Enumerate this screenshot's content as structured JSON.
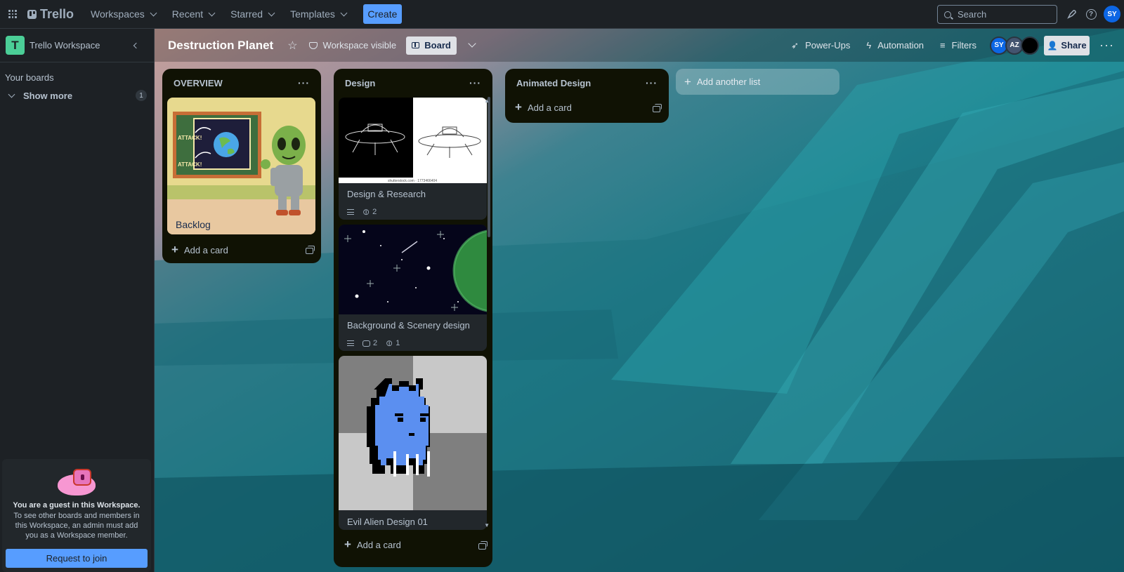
{
  "topbar": {
    "app_name": "Trello",
    "nav": [
      "Workspaces",
      "Recent",
      "Starred",
      "Templates"
    ],
    "create_label": "Create",
    "search_placeholder": "Search",
    "user_initials": "SY"
  },
  "sidebar": {
    "workspace_initial": "T",
    "workspace_name": "Trello Workspace",
    "your_boards_label": "Your boards",
    "show_more_label": "Show more",
    "show_more_count": "1",
    "guest_title": "You are a guest in this Workspace.",
    "guest_text": "To see other boards and members in this Workspace, an admin must add you as a Workspace member.",
    "request_label": "Request to join"
  },
  "board": {
    "title": "Destruction Planet",
    "visibility": "Workspace visible",
    "view_label": "Board",
    "powerups": "Power-Ups",
    "automation": "Automation",
    "filters": "Filters",
    "members": [
      "SY",
      "AZ",
      ""
    ],
    "share_label": "Share",
    "add_list_label": "Add another list",
    "add_card_label": "Add a card"
  },
  "lists": [
    {
      "title": "OVERVIEW",
      "cards": [
        {
          "title": "Backlog"
        }
      ]
    },
    {
      "title": "Design",
      "cards": [
        {
          "title": "Design & Research",
          "attachments": "2",
          "cover_caption": "shutterstock.com · 1773466404"
        },
        {
          "title": "Background & Scenery design",
          "comments": "2",
          "attachments": "1"
        },
        {
          "title": "Evil Alien Design 01"
        }
      ]
    },
    {
      "title": "Animated Design",
      "cards": []
    }
  ],
  "colors": {
    "accent": "#579dff",
    "list_bg": "#101204",
    "card_bg": "#22272b",
    "workspace_logo": "#4bce97"
  }
}
